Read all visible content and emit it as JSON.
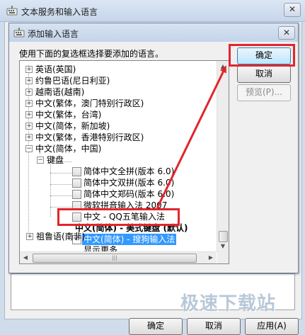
{
  "outer_window": {
    "title": "文本服务和输入语言",
    "close_glyph": "✕",
    "ok_label": "确定",
    "cancel_label": "取消",
    "apply_label": "应用(A)"
  },
  "dialog": {
    "title": "添加输入语言",
    "close_glyph": "✕",
    "instruction": "使用下面的复选框选择要添加的语言。",
    "buttons": {
      "ok": "确定",
      "cancel": "取消",
      "preview": "预览(P)..."
    },
    "tree": {
      "items": [
        {
          "label": "英语(英国)",
          "expander": "+"
        },
        {
          "label": "约鲁巴语(尼日利亚)",
          "expander": "+"
        },
        {
          "label": "越南语(越南)",
          "expander": "+"
        },
        {
          "label": "中文(繁体，澳门特别行政区)",
          "expander": "+"
        },
        {
          "label": "中文(繁体，台湾)",
          "expander": "+"
        },
        {
          "label": "中文(简体，新加坡)",
          "expander": "+"
        },
        {
          "label": "中文(繁体，香港特别行政区)",
          "expander": "+"
        },
        {
          "label": "中文(简体，中国)",
          "expander": "−"
        },
        {
          "label": "键盘",
          "expander": "−"
        },
        {
          "label": "简体中文全拼(版本 6.0)",
          "checked": false
        },
        {
          "label": "简体中文双拼(版本 6.0)",
          "checked": false
        },
        {
          "label": "简体中文郑码(版本 6.0)",
          "checked": false
        },
        {
          "label": "微软拼音输入法 2007",
          "checked": false
        },
        {
          "label": "中文 - QQ五笔输入法",
          "checked": false
        },
        {
          "label": "中文(简体) - 美式键盘 (默认)"
        },
        {
          "label": "中文(简体) - 搜狗输入法",
          "checked": true
        },
        {
          "label": "显示更多..."
        },
        {
          "label": "祖鲁语(南非)",
          "expander": "+"
        }
      ],
      "check_glyph": "✓"
    },
    "scroll_up_glyph": "▲",
    "scroll_down_glyph": "▼",
    "scroll_left_glyph": "◀",
    "scroll_right_glyph": "▶",
    "hscroll_grip": "|||"
  },
  "watermark": "极速下载站",
  "annotation_color": "#e0262e"
}
